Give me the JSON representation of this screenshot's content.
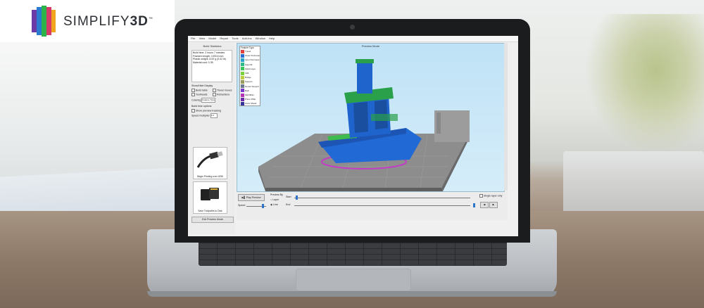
{
  "brand": {
    "name_light": "SIMPLIFY",
    "name_bold": "3D",
    "trademark": "™"
  },
  "menu": [
    "File",
    "View",
    "Model",
    "Repair",
    "Tools",
    "Add-Ins",
    "Window",
    "Help"
  ],
  "left_panel": {
    "title": "Build Statistics",
    "stats_text": "Build time: 2 hours 7 minutes\nFilament length: 1000.6 mm\nPlastic weight: 8.00 g (0.02 lb)\nMaterial cost: 0.35",
    "display_options": "Show/Hide Display",
    "check_items": [
      "Build table",
      "Travel moves",
      "Toolheads",
      "Retractions"
    ],
    "coloring_label": "Coloring",
    "coloring_value": "Feature Type",
    "build_options": "Build time options",
    "preview_checkbox": "Show preview tracking",
    "speed_label": "Speed multiplier",
    "speed_value": "1.0",
    "card1_label": "Begin Printing over USB",
    "card2_label": "Save Toolpaths to Disk",
    "exit_button": "Exit Preview Mode"
  },
  "viewport": {
    "title": "Preview Mode",
    "legend_title": "Feature Type",
    "legend": [
      {
        "label": "Travel",
        "color": "#e0403a"
      },
      {
        "label": "Outer Perimeter",
        "color": "#2b6fd6"
      },
      {
        "label": "Inner Perimeter",
        "color": "#2aa1c9"
      },
      {
        "label": "Gap Fill",
        "color": "#2dbb8a"
      },
      {
        "label": "Solid Layer",
        "color": "#38c85a"
      },
      {
        "label": "Infill",
        "color": "#7ad23a"
      },
      {
        "label": "Bridge",
        "color": "#b9cf3c"
      },
      {
        "label": "Support",
        "color": "#9a9a5a"
      },
      {
        "label": "Dense Support",
        "color": "#6a7a8a"
      },
      {
        "label": "Raft",
        "color": "#7a3ad1"
      },
      {
        "label": "Skirt/Brim",
        "color": "#b534b6"
      },
      {
        "label": "Prime Pillar",
        "color": "#6b2ca9"
      },
      {
        "label": "Ooze Shield",
        "color": "#333399"
      }
    ]
  },
  "bottom": {
    "play_button": "Play Preview",
    "preview_by": "Preview By",
    "layer_label": "Layer",
    "line_label": "Line",
    "start_label": "Start",
    "end_label": "End",
    "single_layer": "Single layer only",
    "speed_label": "Speed"
  }
}
